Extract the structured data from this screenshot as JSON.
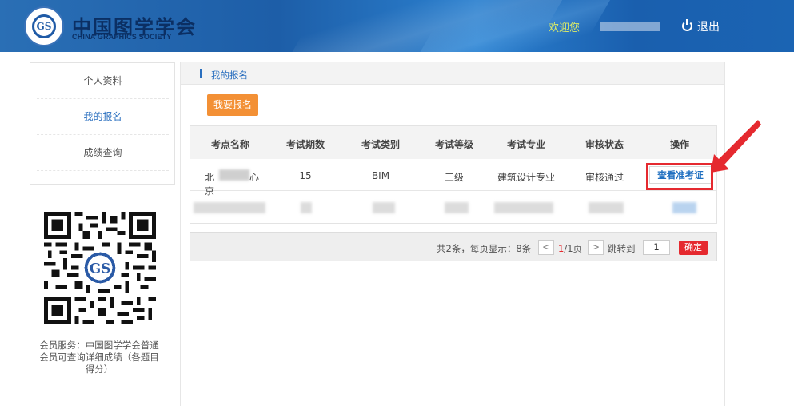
{
  "header": {
    "logo_cn": "中国图学学会",
    "logo_en": "CHINA GRAPHICS SOCIETY",
    "logo_emblem": "GS",
    "welcome": "欢迎您",
    "logout": "退出"
  },
  "sidebar": {
    "items": [
      {
        "label": "个人资料"
      },
      {
        "label": "我的报名"
      },
      {
        "label": "成绩查询"
      }
    ]
  },
  "member_note": "会员服务：中国图学学会普通会员可查询详细成绩（各题目得分）",
  "main": {
    "title": "我的报名",
    "signup_button": "我要报名",
    "columns": [
      "考点名称",
      "考试期数",
      "考试类别",
      "考试等级",
      "考试专业",
      "审核状态",
      "操作"
    ],
    "rows": [
      {
        "site_prefix": "北京",
        "site_suffix": "心",
        "period": "15",
        "category": "BIM",
        "level": "三级",
        "major": "建筑设计专业",
        "status": "审核通过",
        "action": "查看准考证"
      }
    ],
    "pager": {
      "summary": "共2条，每页显示：8条",
      "prev": "<",
      "current": "1",
      "total": "/1页",
      "next": ">",
      "jump_label": "跳转到",
      "jump_value": "1",
      "confirm": "确定"
    }
  },
  "colors": {
    "accent": "#2a6fbf",
    "orange_button": "#f39035",
    "red": "#e5292f",
    "header_blue": "#1d5ea8"
  }
}
